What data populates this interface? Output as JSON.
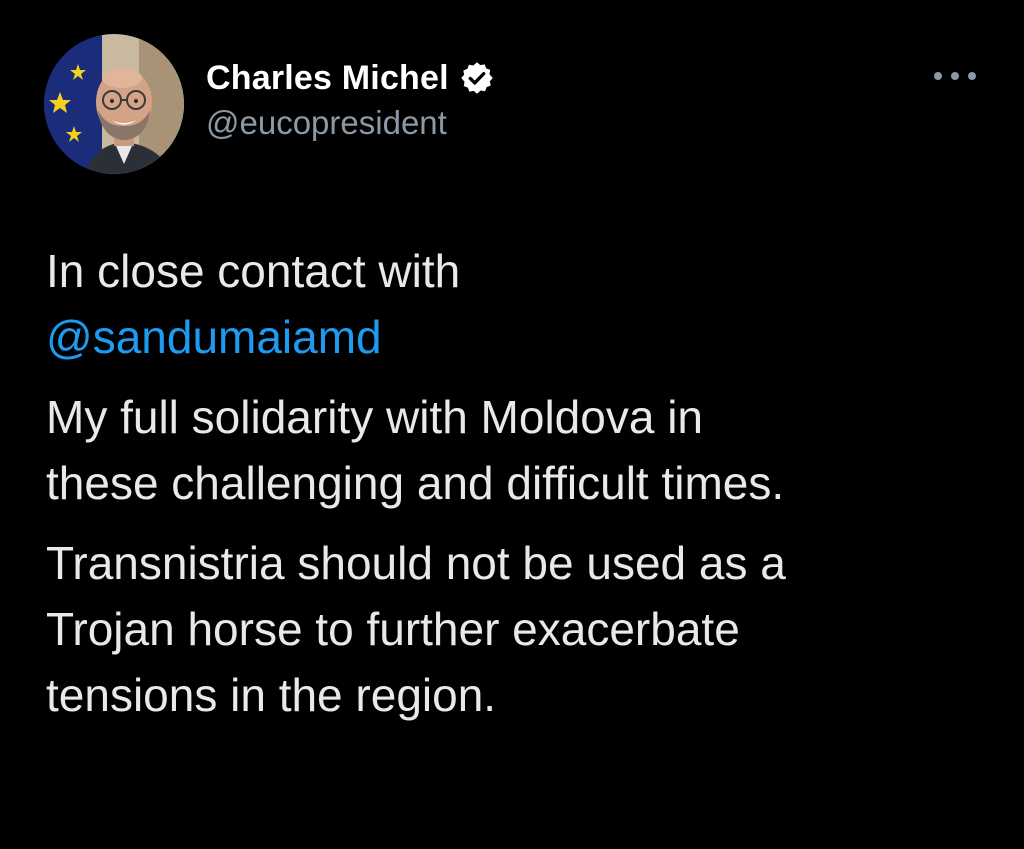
{
  "tweet": {
    "author": {
      "display_name": "Charles Michel",
      "handle": "@eucopresident",
      "verified": true,
      "avatar_icon": "eu-flag-portrait-avatar"
    },
    "more_icon": "ellipsis-icon",
    "body": {
      "para1_line1": "In close contact with",
      "mention": "@sandumaiamd",
      "para2_line1": "My full solidarity with Moldova in",
      "para2_line2": "these challenging and difficult times.",
      "para3_line1": "Transnistria should not be used as a",
      "para3_line2": "Trojan horse to further exacerbate",
      "para3_line3": "tensions in the region."
    }
  },
  "colors": {
    "background": "#000000",
    "text": "#e7e9ea",
    "secondary": "#8b98a5",
    "link": "#1d9bf0",
    "verified_badge": "#ffffff"
  }
}
